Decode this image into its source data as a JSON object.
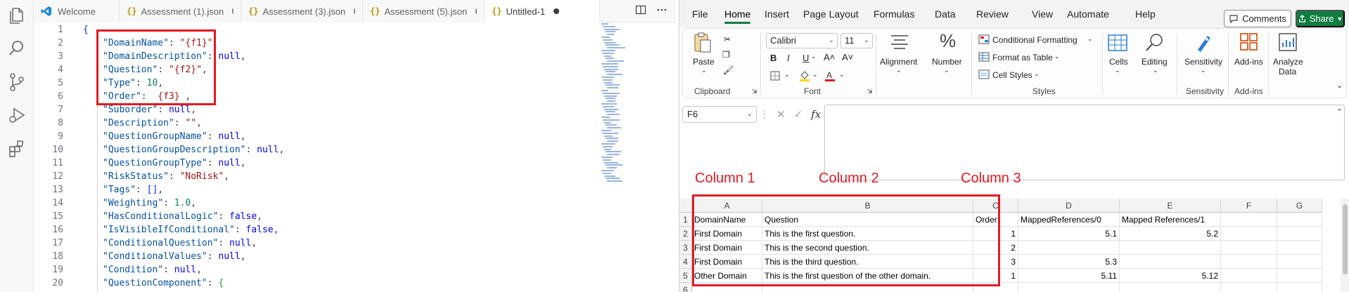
{
  "vscode": {
    "tabs": [
      {
        "label": "Welcome",
        "icon": "vscode-logo-icon",
        "modified": false
      },
      {
        "label": "Assessment (1).json",
        "icon": "json-braces-icon",
        "modified": true
      },
      {
        "label": "Assessment (3).json",
        "icon": "json-braces-icon",
        "modified": true
      },
      {
        "label": "Assessment (5).json",
        "icon": "json-braces-icon",
        "modified": true
      },
      {
        "label": "Untitled-1",
        "icon": "json-braces-icon",
        "modified": true,
        "active": true
      }
    ],
    "activity_icons": [
      "files-explorer-icon",
      "search-icon",
      "source-control-icon",
      "run-debug-icon",
      "extensions-icon"
    ],
    "lines": [
      {
        "num": "1",
        "text": "{"
      },
      {
        "num": "2",
        "key": "\"DomainName\"",
        "value": "\"{f1}\"",
        "vtype": "string",
        "tail": ","
      },
      {
        "num": "3",
        "key": "\"DomainDescription\"",
        "value": "null",
        "vtype": "keyword",
        "tail": ","
      },
      {
        "num": "4",
        "key": "\"Question\"",
        "value": "\"{f2}\"",
        "vtype": "string",
        "tail": ","
      },
      {
        "num": "5",
        "key": "\"Type\"",
        "value": "10",
        "vtype": "number",
        "tail": ","
      },
      {
        "num": "6",
        "key": "\"Order\"",
        "value": " {f3} ",
        "vtype": "string",
        "tail": ","
      },
      {
        "num": "7",
        "key": "\"Suborder\"",
        "value": "null",
        "vtype": "keyword",
        "tail": ","
      },
      {
        "num": "8",
        "key": "\"Description\"",
        "value": "\"\"",
        "vtype": "string",
        "tail": ","
      },
      {
        "num": "9",
        "key": "\"QuestionGroupName\"",
        "value": "null",
        "vtype": "keyword",
        "tail": ","
      },
      {
        "num": "10",
        "key": "\"QuestionGroupDescription\"",
        "value": "null",
        "vtype": "keyword",
        "tail": ","
      },
      {
        "num": "11",
        "key": "\"QuestionGroupType\"",
        "value": "null",
        "vtype": "keyword",
        "tail": ","
      },
      {
        "num": "12",
        "key": "\"RiskStatus\"",
        "value": "\"NoRisk\"",
        "vtype": "string",
        "tail": ","
      },
      {
        "num": "13",
        "key": "\"Tags\"",
        "value": "[]",
        "vtype": "bracket",
        "tail": ","
      },
      {
        "num": "14",
        "key": "\"Weighting\"",
        "value": "1.0",
        "vtype": "number",
        "tail": ","
      },
      {
        "num": "15",
        "key": "\"HasConditionalLogic\"",
        "value": "false",
        "vtype": "keyword",
        "tail": ","
      },
      {
        "num": "16",
        "key": "\"IsVisibleIfConditional\"",
        "value": "false",
        "vtype": "keyword",
        "tail": ","
      },
      {
        "num": "17",
        "key": "\"ConditionalQuestion\"",
        "value": "null",
        "vtype": "keyword",
        "tail": ","
      },
      {
        "num": "18",
        "key": "\"ConditionalValues\"",
        "value": "null",
        "vtype": "keyword",
        "tail": ","
      },
      {
        "num": "19",
        "key": "\"Condition\"",
        "value": "null",
        "vtype": "keyword",
        "tail": ","
      },
      {
        "num": "20",
        "key": "\"QuestionComponent\"",
        "value": "{",
        "vtype": "bracket2",
        "tail": ""
      }
    ]
  },
  "excel": {
    "menu": [
      "File",
      "Home",
      "Insert",
      "Page Layout",
      "Formulas",
      "Data",
      "Review",
      "View",
      "Automate",
      "Help"
    ],
    "active_menu": "Home",
    "comments_label": "Comments",
    "share_label": "Share",
    "ribbon": {
      "paste": "Paste",
      "clipboard": "Clipboard",
      "font_name": "Calibri",
      "font_size": "11",
      "font_group": "Font",
      "alignment": "Alignment",
      "number": "Number",
      "conditional_formatting": "Conditional Formatting",
      "format_as_table": "Format as Table",
      "cell_styles": "Cell Styles",
      "styles_group": "Styles",
      "cells": "Cells",
      "editing": "Editing",
      "sensitivity": "Sensitivity",
      "sensitivity_group": "Sensitivity",
      "add_ins": "Add-ins",
      "add_ins_group": "Add-ins",
      "analyze_data_1": "Analyze",
      "analyze_data_2": "Data",
      "bold": "B",
      "italic": "I",
      "underline": "U",
      "font_grow": "A˄",
      "font_shrink": "A˅",
      "fx": "fx"
    },
    "name_box": "F6",
    "annotations": [
      "Column 1",
      "Column 2",
      "Column 3"
    ],
    "columns": [
      "A",
      "B",
      "C",
      "D",
      "E",
      "F",
      "G"
    ],
    "rows": [
      {
        "num": "1",
        "cells": [
          "DomainName",
          "Question",
          "Order",
          "MappedReferences/0",
          "Mapped References/1",
          "",
          ""
        ]
      },
      {
        "num": "2",
        "cells": [
          "First Domain",
          "This is the first question.",
          "1",
          "5.1",
          "5.2",
          "",
          ""
        ]
      },
      {
        "num": "3",
        "cells": [
          "First Domain",
          "This is the second question.",
          "2",
          "",
          "",
          "",
          ""
        ]
      },
      {
        "num": "4",
        "cells": [
          "First Domain",
          "This is the third question.",
          "3",
          "5.3",
          "",
          "",
          ""
        ]
      },
      {
        "num": "5",
        "cells": [
          "Other Domain",
          "This is the first question of the other domain.",
          "1",
          "5.11",
          "5.12",
          "",
          ""
        ]
      },
      {
        "num": "6",
        "cells": [
          "",
          "",
          "",
          "",
          "",
          "",
          ""
        ]
      }
    ],
    "colors": {
      "accent": "#107c41",
      "annotation": "#e01b24"
    }
  }
}
